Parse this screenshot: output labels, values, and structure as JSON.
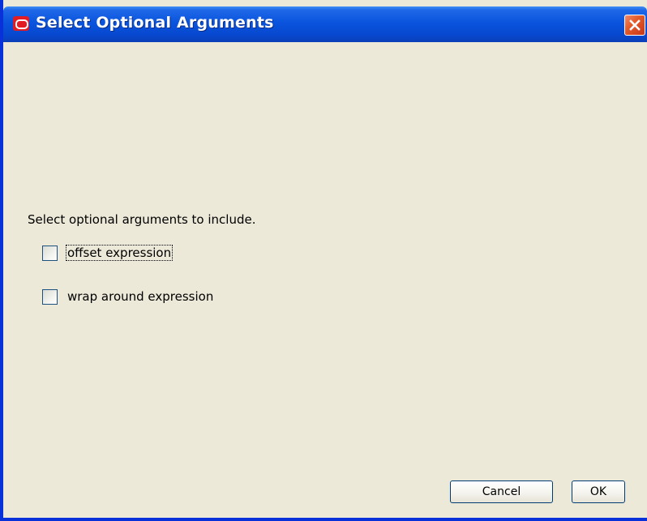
{
  "window": {
    "title": "Select Optional Arguments",
    "title_icon": "oracle-logo-icon",
    "close_icon": "close-icon"
  },
  "dialog": {
    "instruction": "Select optional arguments to include.",
    "options": [
      {
        "label": "offset expression",
        "checked": false,
        "focused": true
      },
      {
        "label": "wrap around expression",
        "checked": false,
        "focused": false
      }
    ]
  },
  "buttons": {
    "cancel": "Cancel",
    "ok": "OK"
  },
  "colors": {
    "titlebar": "#0a54de",
    "dialog_bg": "#ece9d8",
    "close_button": "#e45b2a",
    "logo": "#e31b23"
  }
}
